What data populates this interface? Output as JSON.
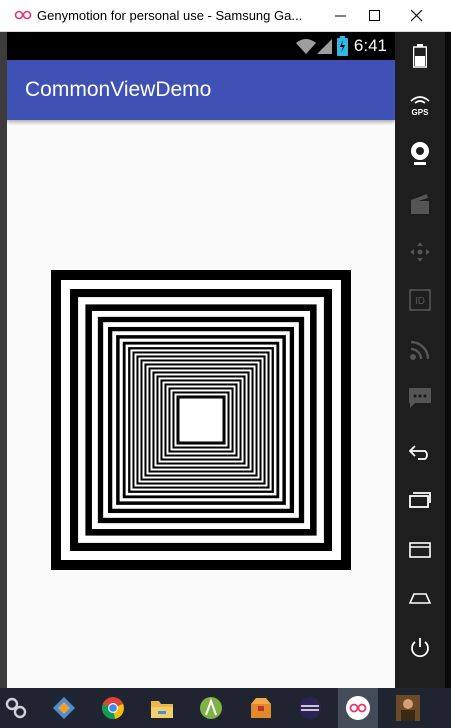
{
  "window": {
    "title": "Genymotion for personal use - Samsung Ga..."
  },
  "statusbar": {
    "time": "6:41",
    "battery_color": "#33b5e5"
  },
  "app": {
    "title": "CommonViewDemo",
    "appbar_color": "#3f51b5",
    "background": "#fafafa"
  },
  "canvas": {
    "description_squares": "nested concentric black and white squares"
  },
  "sidebar": {
    "items": [
      {
        "icon": "battery-icon"
      },
      {
        "icon": "gps-icon",
        "label": "GPS"
      },
      {
        "icon": "webcam-icon"
      },
      {
        "icon": "clapperboard-icon"
      },
      {
        "icon": "dpad-icon"
      },
      {
        "icon": "id-icon",
        "label": "ID"
      },
      {
        "icon": "cast-icon"
      },
      {
        "icon": "sms-icon"
      },
      {
        "icon": "back-icon"
      },
      {
        "icon": "recent-apps-icon"
      },
      {
        "icon": "menu-icon"
      },
      {
        "icon": "home-icon"
      },
      {
        "icon": "power-icon"
      }
    ]
  },
  "taskbar": {
    "items": [
      {
        "icon": "start-icon"
      },
      {
        "icon": "git-icon"
      },
      {
        "icon": "chrome-icon"
      },
      {
        "icon": "explorer-icon"
      },
      {
        "icon": "android-studio-icon"
      },
      {
        "icon": "package-icon"
      },
      {
        "icon": "eclipse-icon"
      },
      {
        "icon": "genymotion-icon"
      },
      {
        "icon": "user-photo-icon"
      }
    ]
  }
}
